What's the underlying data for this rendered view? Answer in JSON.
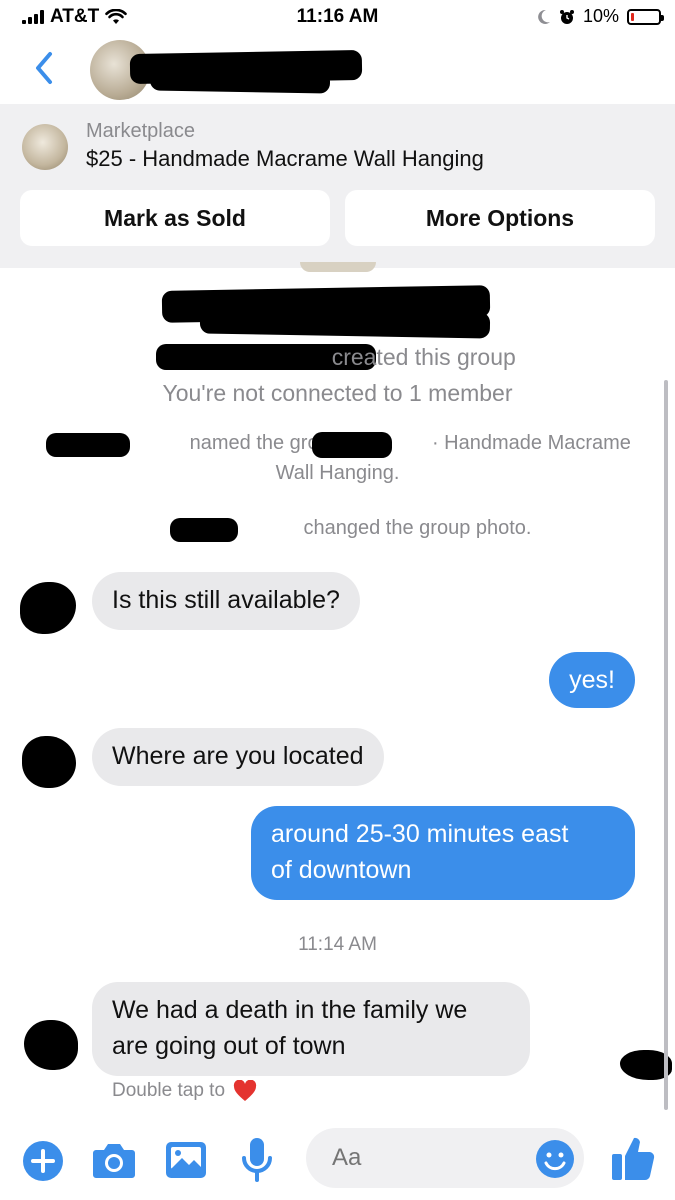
{
  "status_bar": {
    "carrier": "AT&T",
    "time": "11:16 AM",
    "battery": "10%",
    "battery_level": 0.1
  },
  "marketplace": {
    "label": "Marketplace",
    "title": "$25 - Handmade Macrame Wall Hanging",
    "mark_sold_label": "Mark as Sold",
    "more_options_label": "More Options"
  },
  "system_messages": {
    "created_group": "created this group",
    "not_connected": "You're not connected to 1 member",
    "named_group_prefix": "named the group",
    "named_group_suffix": "· Handmade Macrame",
    "named_group_line2": "Wall Hanging.",
    "changed_photo": "changed the group photo."
  },
  "messages": [
    {
      "from": "other",
      "text": "Is this still available?"
    },
    {
      "from": "me",
      "text": "yes!"
    },
    {
      "from": "other",
      "text": "Where are you located"
    },
    {
      "from": "me",
      "line1": "around 25-30 minutes east",
      "line2": "of downtown"
    },
    {
      "from": "other",
      "line1": "We had a death in the family we",
      "line2": "are going out of town"
    }
  ],
  "timestamp": "11:14 AM",
  "double_tap": "Double tap to",
  "composer": {
    "placeholder": "Aa"
  },
  "colors": {
    "accent": "#3b8eea",
    "incoming_bubble": "#e9e9eb",
    "banner_bg": "#f0f0f2"
  }
}
